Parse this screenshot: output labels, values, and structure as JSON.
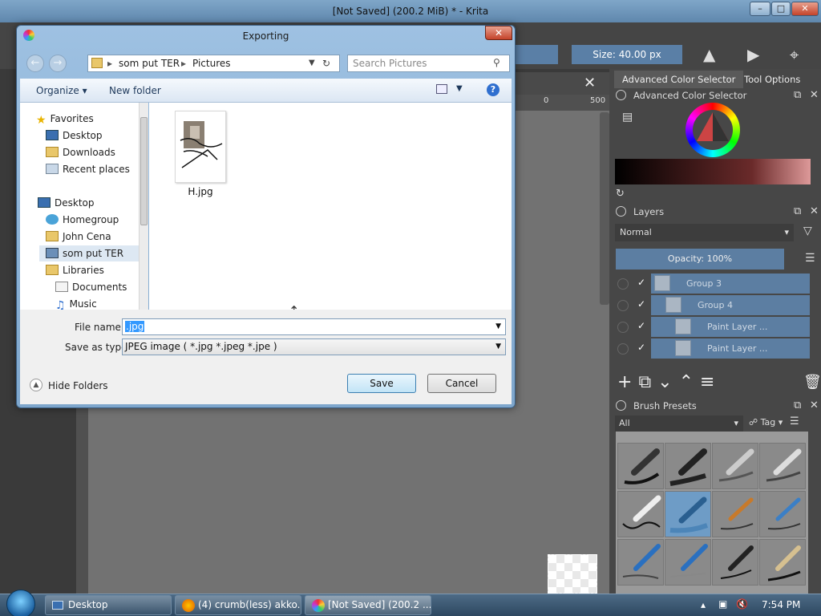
{
  "krita": {
    "window_title": "[Not Saved]  (200.2 MiB) * - Krita",
    "size_field": "Size: 40.00 px",
    "ruler_0": "0",
    "ruler_500": "500",
    "docker_tabs": [
      "Advanced Color Selector",
      "Tool Options"
    ],
    "color_selector_title": "Advanced Color Selector",
    "layers_title": "Layers",
    "blend_mode": "Normal",
    "opacity": "Opacity:  100%",
    "layers": [
      {
        "name": "Group 3"
      },
      {
        "name": "Group 4"
      },
      {
        "name": "Paint Layer ..."
      },
      {
        "name": "Paint Layer ..."
      }
    ],
    "brush_presets_title": "Brush Presets",
    "brush_filter": "All",
    "brush_tag": "Tag"
  },
  "dialog": {
    "title": "Exporting",
    "breadcrumb": [
      "som put TER",
      "Pictures"
    ],
    "search_placeholder": "Search Pictures",
    "organize": "Organize",
    "new_folder": "New folder",
    "nav": {
      "favorites": "Favorites",
      "desktop_fav": "Desktop",
      "downloads": "Downloads",
      "recent": "Recent places",
      "desktop": "Desktop",
      "homegroup": "Homegroup",
      "user": "John Cena",
      "computer": "som put TER",
      "libraries": "Libraries",
      "documents": "Documents",
      "music": "Music"
    },
    "files": [
      {
        "name": "H.jpg"
      }
    ],
    "file_name_label": "File name:",
    "file_name_value": ".jpg",
    "save_as_label": "Save as type:",
    "save_as_value": "JPEG image ( *.jpg *.jpeg *.jpe )",
    "hide_folders": "Hide Folders",
    "save": "Save",
    "cancel": "Cancel"
  },
  "taskbar": {
    "items": [
      "Desktop",
      "(4) crumb(less) akko...",
      "[Not Saved]  (200.2 ..."
    ],
    "clock": "7:54 PM"
  },
  "colors": {
    "accent": "#5c7ea2",
    "dialog_frame": "#8fb3d6"
  }
}
